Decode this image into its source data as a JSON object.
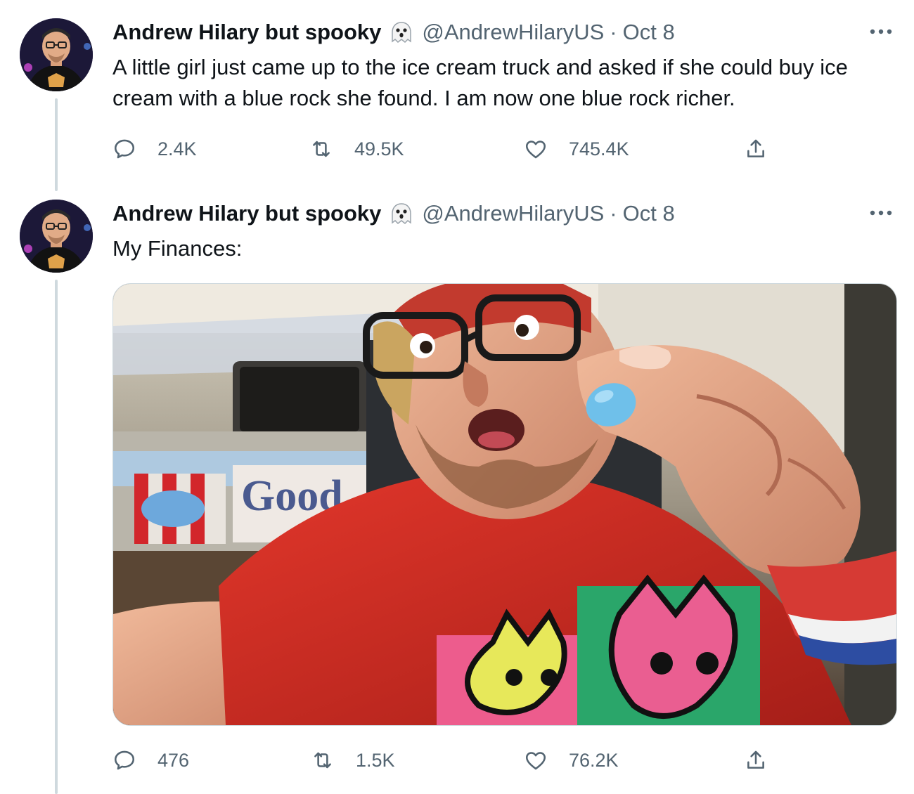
{
  "tweets": [
    {
      "author": {
        "name": "Andrew Hilary but spooky",
        "emoji_icon": "ghost-icon",
        "handle": "@AndrewHilaryUS"
      },
      "separator": "·",
      "date": "Oct 8",
      "text": "A little girl just came up to the ice cream truck and asked if she could buy ice cream with a blue rock she found. I am now one blue rock richer.",
      "stats": {
        "replies": "2.4K",
        "retweets": "49.5K",
        "likes": "745.4K"
      }
    },
    {
      "author": {
        "name": "Andrew Hilary but spooky",
        "emoji_icon": "ghost-icon",
        "handle": "@AndrewHilaryUS"
      },
      "separator": "·",
      "date": "Oct 8",
      "text": "My Finances:",
      "media": {
        "sign_text": "Good"
      },
      "stats": {
        "replies": "476",
        "retweets": "1.5K",
        "likes": "76.2K"
      }
    }
  ],
  "colors": {
    "text_primary": "#0f1419",
    "text_secondary": "#536471",
    "thread_line": "#cfd9de"
  }
}
